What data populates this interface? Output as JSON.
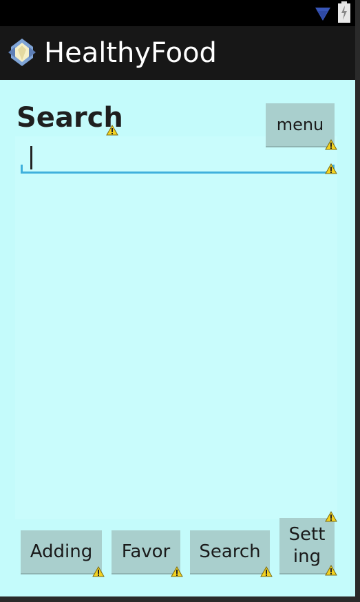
{
  "status_bar": {
    "icons": [
      "wifi-icon",
      "battery-icon"
    ]
  },
  "action_bar": {
    "app_icon": "app-icon",
    "title": "HealthyFood"
  },
  "main": {
    "heading": "Search",
    "menu_button": "menu",
    "search_input": {
      "value": "",
      "placeholder": ""
    }
  },
  "bottom_nav": {
    "adding": "Adding",
    "favor": "Favor",
    "search": "Search",
    "setting": "Sett\ning"
  },
  "colors": {
    "background": "#c4fbfb",
    "action_bar": "#171717",
    "button": "#a9cfcd",
    "input_underline": "#3fb0dc",
    "warning": "#f3d221"
  }
}
